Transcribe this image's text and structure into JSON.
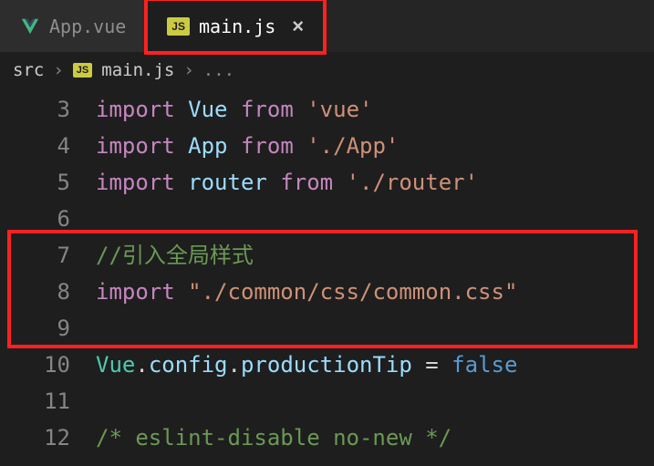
{
  "tabs": {
    "inactive": {
      "label": "App.vue"
    },
    "active": {
      "label": "main.js"
    }
  },
  "breadcrumb": {
    "parts": [
      "src",
      "main.js",
      "..."
    ]
  },
  "lines": {
    "3": {
      "num": "3",
      "kw1": "import",
      "var": "Vue",
      "kw2": "from",
      "str": "'vue'"
    },
    "4": {
      "num": "4",
      "kw1": "import",
      "var": "App",
      "kw2": "from",
      "str": "'./App'"
    },
    "5": {
      "num": "5",
      "kw1": "import",
      "var": "router",
      "kw2": "from",
      "str": "'./router'"
    },
    "6": {
      "num": "6"
    },
    "7": {
      "num": "7",
      "comment": "//引入全局样式"
    },
    "8": {
      "num": "8",
      "kw1": "import",
      "str": "\"./common/css/common.css\""
    },
    "9": {
      "num": "9"
    },
    "10": {
      "num": "10",
      "obj": "Vue",
      "p1": "config",
      "p2": "productionTip",
      "eq": " = ",
      "bool": "false"
    },
    "11": {
      "num": "11"
    },
    "12": {
      "num": "12",
      "comment": "/* eslint-disable no-new */"
    }
  },
  "icons": {
    "js": "JS"
  }
}
